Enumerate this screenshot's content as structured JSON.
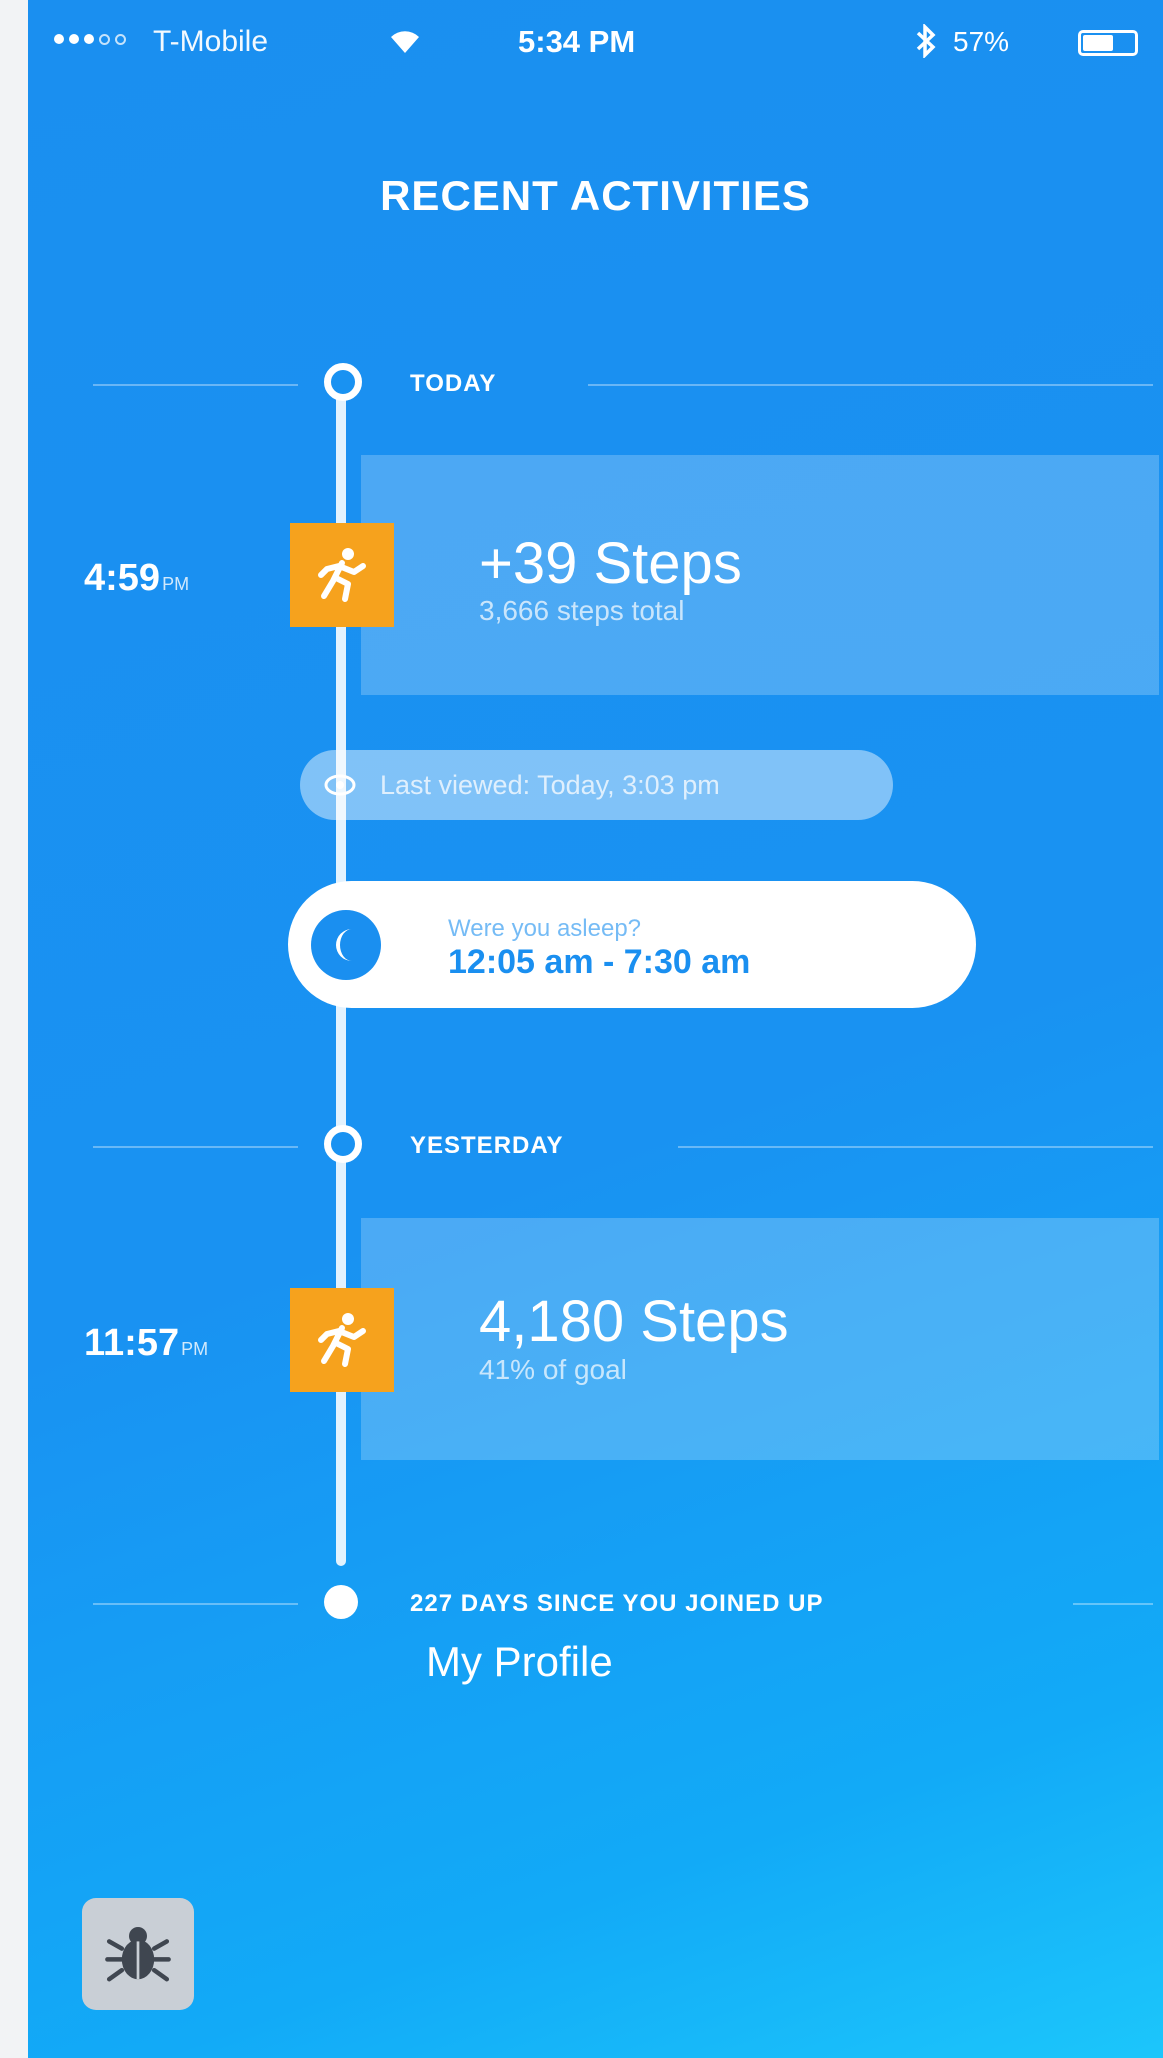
{
  "status_bar": {
    "carrier": "T-Mobile",
    "wifi_icon": "wifi-icon",
    "time": "5:34 PM",
    "bluetooth_icon": "bluetooth-icon",
    "battery_percent": "57%",
    "battery_level": 0.57
  },
  "header": {
    "title": "RECENT ACTIVITIES"
  },
  "today": {
    "label": "TODAY",
    "activity": {
      "time": "4:59",
      "time_suffix": "PM",
      "icon": "runner-icon",
      "title": "+39 Steps",
      "subtitle": "3,666 steps total"
    },
    "last_viewed": "Last viewed: Today, 3:03 pm",
    "sleep": {
      "question": "Were you asleep?",
      "range": "12:05 am - 7:30 am"
    }
  },
  "yesterday": {
    "label": "YESTERDAY",
    "activity": {
      "time": "11:57",
      "time_suffix": "PM",
      "icon": "runner-icon",
      "title": "4,180 Steps",
      "subtitle": "41% of goal"
    }
  },
  "footer": {
    "joined_text": "227 DAYS SINCE YOU JOINED UP",
    "profile_link": "My Profile",
    "debug_icon": "bug-icon"
  },
  "colors": {
    "background": "#1a8ff0",
    "activity_icon": "#f6a21d",
    "card": "rgba(255,255,255,0.22)"
  }
}
